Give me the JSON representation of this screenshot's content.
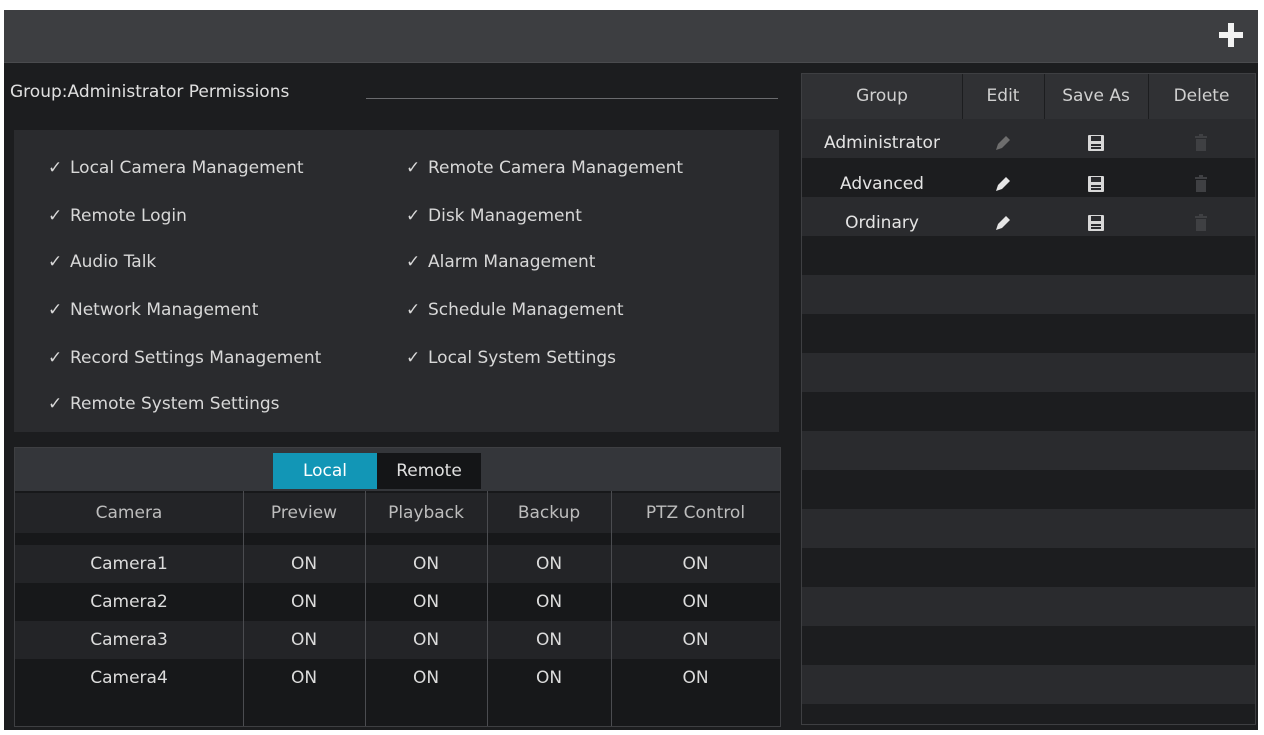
{
  "header": {
    "add_icon": "plus-icon"
  },
  "group_title": "Group:Administrator Permissions",
  "permissions": [
    "Local Camera Management",
    "Remote Camera Management",
    "Remote Login",
    "Disk Management",
    "Audio Talk",
    "Alarm Management",
    "Network Management",
    "Schedule Management",
    "Record Settings Management",
    "Local System Settings",
    "Remote System Settings"
  ],
  "check_glyph": "✓",
  "tabs": {
    "local": "Local",
    "remote": "Remote",
    "active": "Local"
  },
  "camera_table": {
    "headers": [
      "Camera",
      "Preview",
      "Playback",
      "Backup",
      "PTZ Control"
    ],
    "rows": [
      [
        "Camera1",
        "ON",
        "ON",
        "ON",
        "ON"
      ],
      [
        "Camera2",
        "ON",
        "ON",
        "ON",
        "ON"
      ],
      [
        "Camera3",
        "ON",
        "ON",
        "ON",
        "ON"
      ],
      [
        "Camera4",
        "ON",
        "ON",
        "ON",
        "ON"
      ]
    ]
  },
  "group_table": {
    "headers": [
      "Group",
      "Edit",
      "Save As",
      "Delete"
    ],
    "rows": [
      {
        "name": "Administrator",
        "edit_enabled": false,
        "delete_enabled": false
      },
      {
        "name": "Advanced",
        "edit_enabled": true,
        "delete_enabled": false
      },
      {
        "name": "Ordinary",
        "edit_enabled": true,
        "delete_enabled": false
      }
    ],
    "icons": {
      "edit": "pencil-icon",
      "save_as": "floppy-disk-icon",
      "delete": "trash-icon"
    }
  },
  "colors": {
    "accent": "#1296b6",
    "background": "#1c1d1f",
    "panel": "#2a2b2e",
    "header_bar": "#3d3e41"
  }
}
